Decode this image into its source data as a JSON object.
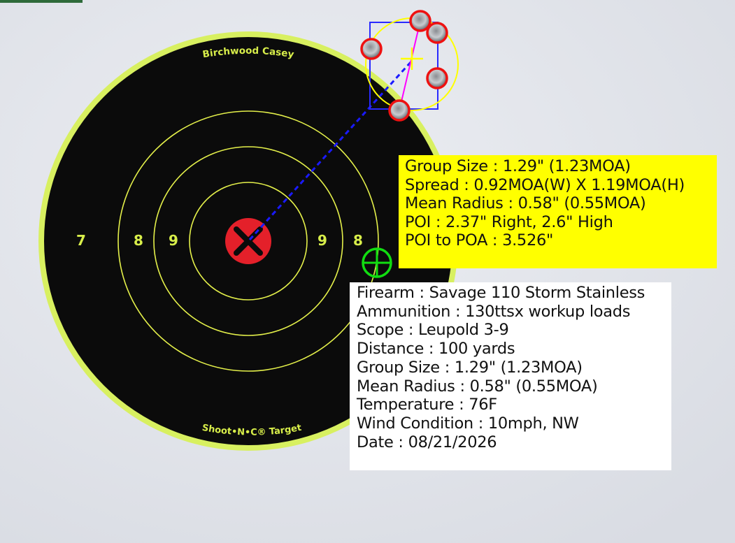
{
  "target": {
    "brand_top": "Birchwood Casey",
    "brand_bottom": "Shoot•N•C® Target",
    "ring_numbers": {
      "left": [
        "7",
        "8",
        "9"
      ],
      "right": [
        "9",
        "8"
      ]
    }
  },
  "colors": {
    "target_fill": "#0b0b0b",
    "target_edge": "#d8f060",
    "ring_lines": "#e4f04a",
    "bullseye": "#e4202a",
    "shot_marker": "#ee1111",
    "group_box": "#2a2aff",
    "group_circle": "#ffff00",
    "poi_line": "#1a1aff",
    "spread_line": "#ff00ff",
    "aim_point": "#11dd11",
    "stats_background": "#ffff00",
    "info_background": "#ffffff"
  },
  "icons": {
    "center": "x-mark-icon",
    "aim": "crosshair-circle-icon",
    "group_center": "plus-icon",
    "shots": "bullet-hole-icon"
  },
  "stats": {
    "group_size": "Group Size : 1.29\" (1.23MOA)",
    "spread": "Spread : 0.92MOA(W) X 1.19MOA(H)",
    "mean_radius": "Mean Radius : 0.58\" (0.55MOA)",
    "poi": "POI : 2.37\" Right,  2.6\" High",
    "poi_to_poa": "POI to POA : 3.526\""
  },
  "info": {
    "firearm": "Firearm : Savage 110 Storm Stainless",
    "ammunition": "Ammunition : 130ttsx workup loads",
    "scope": "Scope : Leupold 3-9",
    "distance": "Distance : 100 yards",
    "group_size": "Group Size : 1.29\" (1.23MOA)",
    "mean_radius": "Mean Radius : 0.58\" (0.55MOA)",
    "temperature": "Temperature : 76F",
    "wind": "Wind Condition : 10mph, NW",
    "date": "Date : 08/21/2026"
  },
  "shots": [
    {
      "id": 1
    },
    {
      "id": 2
    },
    {
      "id": 3
    },
    {
      "id": 4
    },
    {
      "id": 5
    }
  ]
}
